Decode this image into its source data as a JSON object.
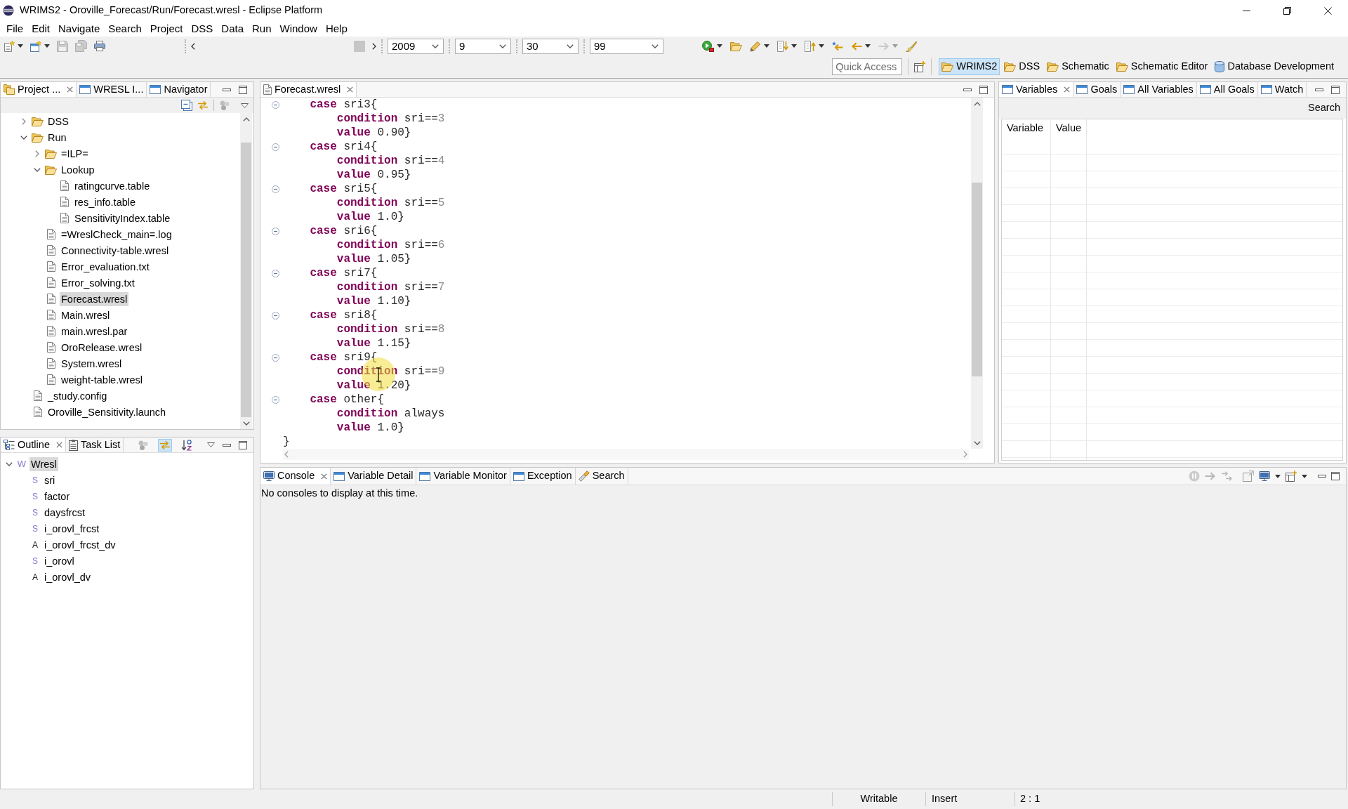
{
  "window": {
    "title": "WRIMS2 - Oroville_Forecast/Run/Forecast.wresl - Eclipse Platform"
  },
  "menu": [
    "File",
    "Edit",
    "Navigate",
    "Search",
    "Project",
    "DSS",
    "Data",
    "Run",
    "Window",
    "Help"
  ],
  "toolbar": {
    "left_buttons": [
      {
        "kind": "new-file",
        "has_menu": true,
        "disabled": false
      },
      {
        "kind": "new-window",
        "has_menu": true,
        "disabled": false
      },
      {
        "kind": "save",
        "has_menu": false,
        "disabled": true
      },
      {
        "kind": "save-all",
        "has_menu": false,
        "disabled": true
      },
      {
        "kind": "print",
        "has_menu": false,
        "disabled": false
      }
    ],
    "date_fields": [
      {
        "value": "2009"
      },
      {
        "value": "9"
      },
      {
        "value": "30"
      },
      {
        "value": "99"
      }
    ],
    "right_buttons": [
      {
        "kind": "run",
        "has_menu": true,
        "disabled": false
      },
      {
        "kind": "open",
        "has_menu": false,
        "disabled": false
      },
      {
        "kind": "pen",
        "has_menu": true,
        "disabled": false
      },
      {
        "kind": "next-annotation",
        "has_menu": true,
        "disabled": false
      },
      {
        "kind": "previous-annotation",
        "has_menu": true,
        "disabled": false
      },
      {
        "kind": "last-edit",
        "has_menu": false,
        "disabled": false
      },
      {
        "kind": "back",
        "has_menu": true,
        "disabled": false
      },
      {
        "kind": "forward",
        "has_menu": true,
        "disabled": true
      },
      {
        "kind": "brush",
        "has_menu": false,
        "disabled": false
      }
    ],
    "quick_access": {
      "placeholder": "Quick Access"
    },
    "perspectives": [
      {
        "label": "WRIMS2",
        "kind": "folder",
        "selected": true
      },
      {
        "label": "DSS",
        "kind": "folder",
        "selected": false
      },
      {
        "label": "Schematic",
        "kind": "folder",
        "selected": false
      },
      {
        "label": "Schematic Editor",
        "kind": "folder",
        "selected": false
      },
      {
        "label": "Database Development",
        "kind": "database",
        "selected": false
      }
    ]
  },
  "project_explorer": {
    "tabs": [
      {
        "label": "Project ...",
        "kind": "explorer",
        "selected": true
      },
      {
        "label": "WRESL I...",
        "kind": "view",
        "selected": false
      },
      {
        "label": "Navigator",
        "kind": "view",
        "selected": false
      }
    ],
    "tree": [
      {
        "label": "DSS",
        "kind": "folder",
        "expanded": false,
        "selected": false
      },
      {
        "label": "Run",
        "kind": "folder",
        "expanded": true,
        "selected": false,
        "children": [
          {
            "label": "=ILP=",
            "kind": "folder",
            "expanded": false,
            "selected": false
          },
          {
            "label": "Lookup",
            "kind": "folder",
            "expanded": true,
            "selected": false,
            "children": [
              {
                "label": "ratingcurve.table",
                "kind": "file",
                "selected": false
              },
              {
                "label": "res_info.table",
                "kind": "file",
                "selected": false
              },
              {
                "label": "SensitivityIndex.table",
                "kind": "file",
                "selected": false
              }
            ]
          },
          {
            "label": "=WreslCheck_main=.log",
            "kind": "file",
            "selected": false
          },
          {
            "label": "Connectivity-table.wresl",
            "kind": "file",
            "selected": false
          },
          {
            "label": "Error_evaluation.txt",
            "kind": "file",
            "selected": false
          },
          {
            "label": "Error_solving.txt",
            "kind": "file",
            "selected": false
          },
          {
            "label": "Forecast.wresl",
            "kind": "file",
            "selected": true
          },
          {
            "label": "Main.wresl",
            "kind": "file",
            "selected": false
          },
          {
            "label": "main.wresl.par",
            "kind": "file",
            "selected": false
          },
          {
            "label": "OroRelease.wresl",
            "kind": "file",
            "selected": false
          },
          {
            "label": "System.wresl",
            "kind": "file",
            "selected": false
          },
          {
            "label": "weight-table.wresl",
            "kind": "file",
            "selected": false
          }
        ]
      },
      {
        "label": "_study.config",
        "kind": "file",
        "selected": false
      },
      {
        "label": "Oroville_Sensitivity.launch",
        "kind": "file",
        "selected": false
      }
    ]
  },
  "outline": {
    "tabs": [
      {
        "label": "Outline",
        "kind": "outline",
        "selected": true
      },
      {
        "label": "Task List",
        "kind": "task-list",
        "selected": false
      }
    ],
    "toggles": [
      {
        "kind": "filter",
        "on": false
      },
      {
        "kind": "link",
        "on": true
      },
      {
        "kind": "sort",
        "on": false
      }
    ],
    "tree": [
      {
        "label": "Wresl",
        "marker": "W",
        "kind": "file",
        "selected": true,
        "expanded": true,
        "children": [
          {
            "label": "sri",
            "marker": "S",
            "kind": "svar",
            "selected": false
          },
          {
            "label": "factor",
            "marker": "S",
            "kind": "svar",
            "selected": false
          },
          {
            "label": "daysfrcst",
            "marker": "S",
            "kind": "svar",
            "selected": false
          },
          {
            "label": "i_orovl_frcst",
            "marker": "S",
            "kind": "svar",
            "selected": false
          },
          {
            "label": "i_orovl_frcst_dv",
            "marker": "A",
            "kind": "alias",
            "selected": false
          },
          {
            "label": "i_orovl",
            "marker": "S",
            "kind": "svar",
            "selected": false
          },
          {
            "label": "i_orovl_dv",
            "marker": "A",
            "kind": "alias",
            "selected": false
          }
        ]
      }
    ]
  },
  "editor": {
    "tabs": [
      {
        "label": "Forecast.wresl",
        "kind": "file",
        "selected": true
      }
    ],
    "lines": [
      {
        "foldable": true,
        "tokens": [
          {
            "kind": "keyword",
            "text": "    case"
          },
          {
            "kind": "plain",
            "text": " sri3{"
          }
        ]
      },
      {
        "foldable": false,
        "tokens": [
          {
            "kind": "keyword",
            "text": "        condition"
          },
          {
            "kind": "plain",
            "text": " sri=="
          },
          {
            "kind": "number",
            "text": "3"
          }
        ]
      },
      {
        "foldable": false,
        "tokens": [
          {
            "kind": "keyword",
            "text": "        value"
          },
          {
            "kind": "plain",
            "text": " 0.90}"
          }
        ]
      },
      {
        "foldable": true,
        "tokens": [
          {
            "kind": "keyword",
            "text": "    case"
          },
          {
            "kind": "plain",
            "text": " sri4{"
          }
        ]
      },
      {
        "foldable": false,
        "tokens": [
          {
            "kind": "keyword",
            "text": "        condition"
          },
          {
            "kind": "plain",
            "text": " sri=="
          },
          {
            "kind": "number",
            "text": "4"
          }
        ]
      },
      {
        "foldable": false,
        "tokens": [
          {
            "kind": "keyword",
            "text": "        value"
          },
          {
            "kind": "plain",
            "text": " 0.95}"
          }
        ]
      },
      {
        "foldable": true,
        "tokens": [
          {
            "kind": "keyword",
            "text": "    case"
          },
          {
            "kind": "plain",
            "text": " sri5{"
          }
        ]
      },
      {
        "foldable": false,
        "tokens": [
          {
            "kind": "keyword",
            "text": "        condition"
          },
          {
            "kind": "plain",
            "text": " sri=="
          },
          {
            "kind": "number",
            "text": "5"
          }
        ]
      },
      {
        "foldable": false,
        "tokens": [
          {
            "kind": "keyword",
            "text": "        value"
          },
          {
            "kind": "plain",
            "text": " 1.0}"
          }
        ]
      },
      {
        "foldable": true,
        "tokens": [
          {
            "kind": "keyword",
            "text": "    case"
          },
          {
            "kind": "plain",
            "text": " sri6{"
          }
        ]
      },
      {
        "foldable": false,
        "tokens": [
          {
            "kind": "keyword",
            "text": "        condition"
          },
          {
            "kind": "plain",
            "text": " sri=="
          },
          {
            "kind": "number",
            "text": "6"
          }
        ]
      },
      {
        "foldable": false,
        "tokens": [
          {
            "kind": "keyword",
            "text": "        value"
          },
          {
            "kind": "plain",
            "text": " 1.05}"
          }
        ]
      },
      {
        "foldable": true,
        "tokens": [
          {
            "kind": "keyword",
            "text": "    case"
          },
          {
            "kind": "plain",
            "text": " sri7{"
          }
        ]
      },
      {
        "foldable": false,
        "tokens": [
          {
            "kind": "keyword",
            "text": "        condition"
          },
          {
            "kind": "plain",
            "text": " sri=="
          },
          {
            "kind": "number",
            "text": "7"
          }
        ]
      },
      {
        "foldable": false,
        "tokens": [
          {
            "kind": "keyword",
            "text": "        value"
          },
          {
            "kind": "plain",
            "text": " 1.10}"
          }
        ]
      },
      {
        "foldable": true,
        "tokens": [
          {
            "kind": "keyword",
            "text": "    case"
          },
          {
            "kind": "plain",
            "text": " sri8{"
          }
        ]
      },
      {
        "foldable": false,
        "tokens": [
          {
            "kind": "keyword",
            "text": "        condition"
          },
          {
            "kind": "plain",
            "text": " sri=="
          },
          {
            "kind": "number",
            "text": "8"
          }
        ]
      },
      {
        "foldable": false,
        "tokens": [
          {
            "kind": "keyword",
            "text": "        value"
          },
          {
            "kind": "plain",
            "text": " 1.15}"
          }
        ]
      },
      {
        "foldable": true,
        "tokens": [
          {
            "kind": "keyword",
            "text": "    case"
          },
          {
            "kind": "plain",
            "text": " sri9{"
          }
        ]
      },
      {
        "foldable": false,
        "tokens": [
          {
            "kind": "keyword",
            "text": "        condition"
          },
          {
            "kind": "plain",
            "text": " sri=="
          },
          {
            "kind": "number",
            "text": "9"
          }
        ]
      },
      {
        "foldable": false,
        "tokens": [
          {
            "kind": "keyword",
            "text": "        value"
          },
          {
            "kind": "plain",
            "text": " 1.20}"
          }
        ]
      },
      {
        "foldable": true,
        "tokens": [
          {
            "kind": "keyword",
            "text": "    case"
          },
          {
            "kind": "plain",
            "text": " other{"
          }
        ]
      },
      {
        "foldable": false,
        "tokens": [
          {
            "kind": "keyword",
            "text": "        condition"
          },
          {
            "kind": "plain",
            "text": " always"
          }
        ]
      },
      {
        "foldable": false,
        "tokens": [
          {
            "kind": "keyword",
            "text": "        value"
          },
          {
            "kind": "plain",
            "text": " 1.0}"
          }
        ]
      },
      {
        "foldable": false,
        "tokens": [
          {
            "kind": "plain",
            "text": "}"
          }
        ]
      }
    ],
    "mouse_pointer": {
      "highlighted": true
    }
  },
  "variables_view": {
    "tabs": [
      {
        "label": "Variables",
        "kind": "view",
        "selected": true
      },
      {
        "label": "Goals",
        "kind": "view",
        "selected": false
      },
      {
        "label": "All Variables",
        "kind": "view",
        "selected": false
      },
      {
        "label": "All Goals",
        "kind": "view",
        "selected": false
      },
      {
        "label": "Watch",
        "kind": "view",
        "selected": false
      }
    ],
    "search_button": "Search",
    "table": {
      "columns": [
        "Variable",
        "Value"
      ]
    }
  },
  "console_view": {
    "tabs": [
      {
        "label": "Console",
        "kind": "console",
        "selected": true
      },
      {
        "label": "Variable Detail",
        "kind": "view",
        "selected": false
      },
      {
        "label": "Variable Monitor",
        "kind": "view",
        "selected": false
      },
      {
        "label": "Exception",
        "kind": "view",
        "selected": false
      },
      {
        "label": "Search",
        "kind": "search",
        "selected": false
      }
    ],
    "message": "No consoles to display at this time."
  },
  "status_bar": [
    "Writable",
    "Insert",
    "2 : 1"
  ]
}
